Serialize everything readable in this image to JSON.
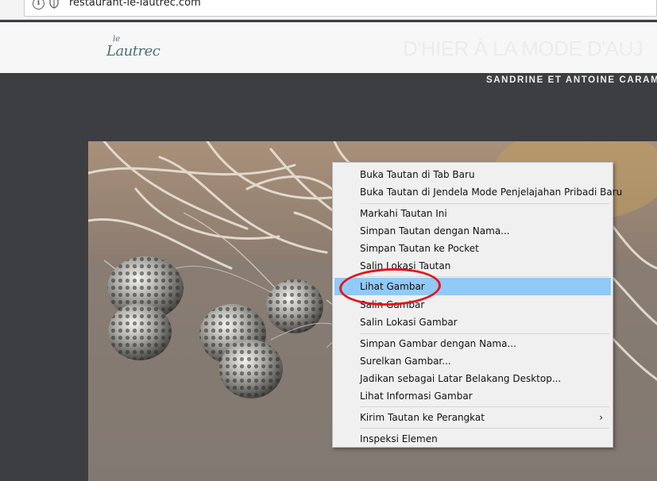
{
  "browser": {
    "url": "restaurant-le-lautrec.com",
    "icons": [
      "info-icon",
      "shield-icon"
    ]
  },
  "site": {
    "logo_small": "le",
    "logo_main": "Lautrec",
    "tagline": "D'HIER À LA MODE D'AUJ",
    "owners": "SANDRINE ET ANTOINE CARAM"
  },
  "context_menu": {
    "items": [
      {
        "label": "Buka Tautan di Tab Baru"
      },
      {
        "label": "Buka Tautan di Jendela Mode Penjelajahan Pribadi Baru"
      },
      {
        "label": "Markahi Tautan Ini"
      },
      {
        "label": "Simpan Tautan dengan Nama..."
      },
      {
        "label": "Simpan Tautan ke Pocket"
      },
      {
        "label": "Salin Lokasi Tautan"
      },
      {
        "label": "Lihat Gambar",
        "highlighted": true
      },
      {
        "label": "Salin Gambar"
      },
      {
        "label": "Salin Lokasi Gambar"
      },
      {
        "label": "Simpan Gambar dengan Nama..."
      },
      {
        "label": "Surelkan Gambar..."
      },
      {
        "label": "Jadikan sebagai Latar Belakang Desktop..."
      },
      {
        "label": "Lihat Informasi Gambar"
      },
      {
        "label": "Kirim Tautan ke Perangkat",
        "submenu_icon": "chevron-right-icon"
      },
      {
        "label": "Inspeksi Elemen"
      }
    ]
  },
  "colors": {
    "highlight": "#91c9f7",
    "annotation_circle": "#e3151c",
    "logo": "#4d6f73",
    "page_background": "#3c3e42"
  }
}
